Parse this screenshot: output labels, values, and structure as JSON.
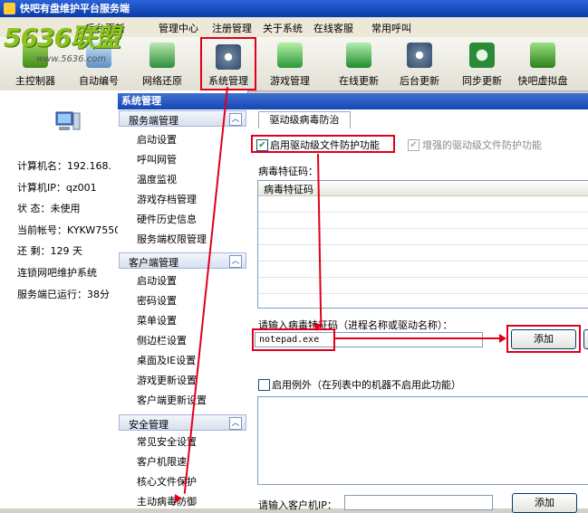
{
  "window": {
    "title": "快吧有盘维护平台服务端"
  },
  "logo": {
    "text": "5636联盟",
    "url": "www.5636.com"
  },
  "menu": [
    "系统",
    "后台更新",
    "管理中心",
    "注册管理",
    "关于系统",
    "在线客服",
    "常用呼叫"
  ],
  "toolbar": [
    {
      "label": "主控制器",
      "icon": "controller-icon"
    },
    {
      "label": "自动编号",
      "icon": "number-icon"
    },
    {
      "label": "网络还原",
      "icon": "network-restore-icon"
    },
    {
      "label": "系统管理",
      "icon": "gear-icon"
    },
    {
      "label": "游戏管理",
      "icon": "game-icon"
    },
    {
      "label": "在线更新",
      "icon": "update-icon"
    },
    {
      "label": "后台更新",
      "icon": "backend-update-icon"
    },
    {
      "label": "同步更新",
      "icon": "sync-icon"
    },
    {
      "label": "快吧虚拟盘",
      "icon": "virtual-disk-icon"
    }
  ],
  "server_info": [
    {
      "label": "计算机名：",
      "value": "192.168."
    },
    {
      "label": "计算机IP：",
      "value": "qz001"
    },
    {
      "label": "状    态：",
      "value": "未使用"
    },
    {
      "label": "当前帐号：",
      "value": "KYKW7550"
    },
    {
      "label": "还    剩：",
      "value": "129 天"
    },
    {
      "label": "连锁网吧维护系统",
      "value": ""
    },
    {
      "label": "服务端已运行：",
      "value": "38分"
    }
  ],
  "panel_title": "系统管理",
  "groups": [
    {
      "title": "服务端管理",
      "items": [
        "启动设置",
        "呼叫网管",
        "温度监视",
        "游戏存档管理",
        "硬件历史信息",
        "服务端权限管理"
      ]
    },
    {
      "title": "客户端管理",
      "items": [
        "启动设置",
        "密码设置",
        "菜单设置",
        "侧边栏设置",
        "桌面及IE设置",
        "游戏更新设置",
        "客户端更新设置"
      ]
    },
    {
      "title": "安全管理",
      "items": [
        "常见安全设置",
        "客户机限速",
        "核心文件保护",
        "主动病毒防御"
      ]
    }
  ],
  "content": {
    "tab": "驱动级病毒防治",
    "enable_driver_protect": "启用驱动级文件防护功能",
    "enhanced_protect": "增强的驱动级文件防护功能",
    "virus_feature_label": "病毒特征码：",
    "virus_feature_col": "病毒特征码",
    "input_prompt": "请输入病毒特征码（进程名称或驱动名称）：",
    "input_value": "notepad.exe",
    "add_label": "添加",
    "exception_label": "启用例外（在列表中的机器不启用此功能）",
    "client_ip_prompt": "请输入客户机IP：",
    "add_label2": "添加"
  },
  "colors": {
    "highlight": "#e0001a",
    "title_bar": "#0a3ca8",
    "logo": "#8ec21f"
  }
}
